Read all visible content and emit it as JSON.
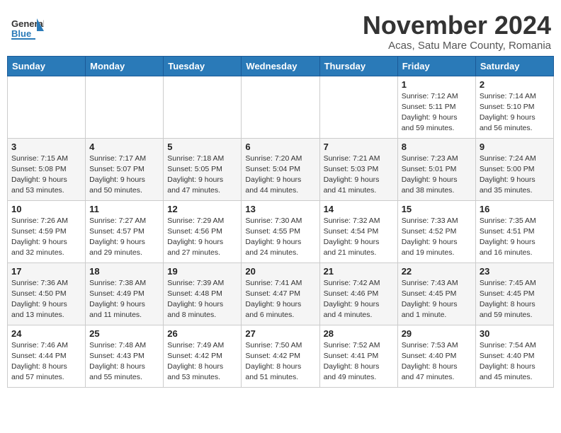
{
  "header": {
    "logo_general": "General",
    "logo_blue": "Blue",
    "month": "November 2024",
    "location": "Acas, Satu Mare County, Romania"
  },
  "weekdays": [
    "Sunday",
    "Monday",
    "Tuesday",
    "Wednesday",
    "Thursday",
    "Friday",
    "Saturday"
  ],
  "weeks": [
    [
      {
        "day": "",
        "info": ""
      },
      {
        "day": "",
        "info": ""
      },
      {
        "day": "",
        "info": ""
      },
      {
        "day": "",
        "info": ""
      },
      {
        "day": "",
        "info": ""
      },
      {
        "day": "1",
        "info": "Sunrise: 7:12 AM\nSunset: 5:11 PM\nDaylight: 9 hours and 59 minutes."
      },
      {
        "day": "2",
        "info": "Sunrise: 7:14 AM\nSunset: 5:10 PM\nDaylight: 9 hours and 56 minutes."
      }
    ],
    [
      {
        "day": "3",
        "info": "Sunrise: 7:15 AM\nSunset: 5:08 PM\nDaylight: 9 hours and 53 minutes."
      },
      {
        "day": "4",
        "info": "Sunrise: 7:17 AM\nSunset: 5:07 PM\nDaylight: 9 hours and 50 minutes."
      },
      {
        "day": "5",
        "info": "Sunrise: 7:18 AM\nSunset: 5:05 PM\nDaylight: 9 hours and 47 minutes."
      },
      {
        "day": "6",
        "info": "Sunrise: 7:20 AM\nSunset: 5:04 PM\nDaylight: 9 hours and 44 minutes."
      },
      {
        "day": "7",
        "info": "Sunrise: 7:21 AM\nSunset: 5:03 PM\nDaylight: 9 hours and 41 minutes."
      },
      {
        "day": "8",
        "info": "Sunrise: 7:23 AM\nSunset: 5:01 PM\nDaylight: 9 hours and 38 minutes."
      },
      {
        "day": "9",
        "info": "Sunrise: 7:24 AM\nSunset: 5:00 PM\nDaylight: 9 hours and 35 minutes."
      }
    ],
    [
      {
        "day": "10",
        "info": "Sunrise: 7:26 AM\nSunset: 4:59 PM\nDaylight: 9 hours and 32 minutes."
      },
      {
        "day": "11",
        "info": "Sunrise: 7:27 AM\nSunset: 4:57 PM\nDaylight: 9 hours and 29 minutes."
      },
      {
        "day": "12",
        "info": "Sunrise: 7:29 AM\nSunset: 4:56 PM\nDaylight: 9 hours and 27 minutes."
      },
      {
        "day": "13",
        "info": "Sunrise: 7:30 AM\nSunset: 4:55 PM\nDaylight: 9 hours and 24 minutes."
      },
      {
        "day": "14",
        "info": "Sunrise: 7:32 AM\nSunset: 4:54 PM\nDaylight: 9 hours and 21 minutes."
      },
      {
        "day": "15",
        "info": "Sunrise: 7:33 AM\nSunset: 4:52 PM\nDaylight: 9 hours and 19 minutes."
      },
      {
        "day": "16",
        "info": "Sunrise: 7:35 AM\nSunset: 4:51 PM\nDaylight: 9 hours and 16 minutes."
      }
    ],
    [
      {
        "day": "17",
        "info": "Sunrise: 7:36 AM\nSunset: 4:50 PM\nDaylight: 9 hours and 13 minutes."
      },
      {
        "day": "18",
        "info": "Sunrise: 7:38 AM\nSunset: 4:49 PM\nDaylight: 9 hours and 11 minutes."
      },
      {
        "day": "19",
        "info": "Sunrise: 7:39 AM\nSunset: 4:48 PM\nDaylight: 9 hours and 8 minutes."
      },
      {
        "day": "20",
        "info": "Sunrise: 7:41 AM\nSunset: 4:47 PM\nDaylight: 9 hours and 6 minutes."
      },
      {
        "day": "21",
        "info": "Sunrise: 7:42 AM\nSunset: 4:46 PM\nDaylight: 9 hours and 4 minutes."
      },
      {
        "day": "22",
        "info": "Sunrise: 7:43 AM\nSunset: 4:45 PM\nDaylight: 9 hours and 1 minute."
      },
      {
        "day": "23",
        "info": "Sunrise: 7:45 AM\nSunset: 4:45 PM\nDaylight: 8 hours and 59 minutes."
      }
    ],
    [
      {
        "day": "24",
        "info": "Sunrise: 7:46 AM\nSunset: 4:44 PM\nDaylight: 8 hours and 57 minutes."
      },
      {
        "day": "25",
        "info": "Sunrise: 7:48 AM\nSunset: 4:43 PM\nDaylight: 8 hours and 55 minutes."
      },
      {
        "day": "26",
        "info": "Sunrise: 7:49 AM\nSunset: 4:42 PM\nDaylight: 8 hours and 53 minutes."
      },
      {
        "day": "27",
        "info": "Sunrise: 7:50 AM\nSunset: 4:42 PM\nDaylight: 8 hours and 51 minutes."
      },
      {
        "day": "28",
        "info": "Sunrise: 7:52 AM\nSunset: 4:41 PM\nDaylight: 8 hours and 49 minutes."
      },
      {
        "day": "29",
        "info": "Sunrise: 7:53 AM\nSunset: 4:40 PM\nDaylight: 8 hours and 47 minutes."
      },
      {
        "day": "30",
        "info": "Sunrise: 7:54 AM\nSunset: 4:40 PM\nDaylight: 8 hours and 45 minutes."
      }
    ]
  ]
}
